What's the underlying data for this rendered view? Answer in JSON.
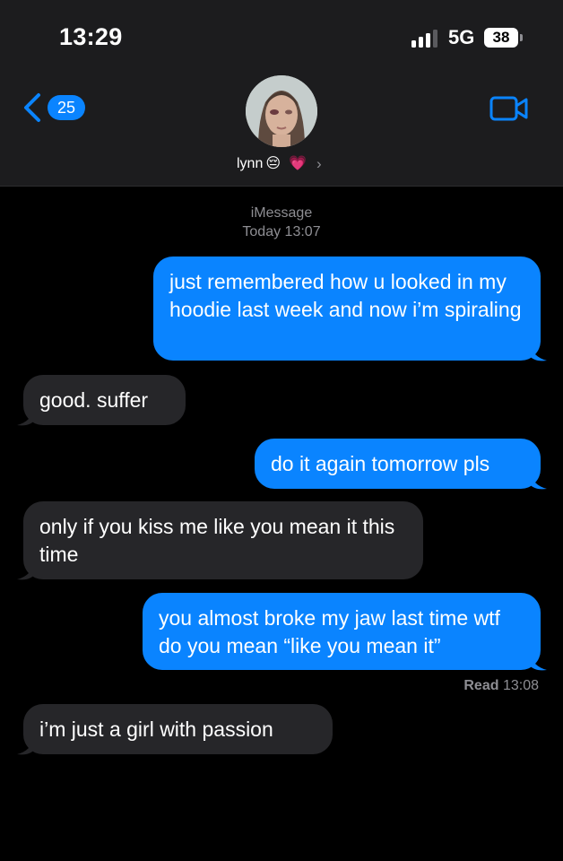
{
  "status_bar": {
    "time": "13:29",
    "network": "5G",
    "battery": "38"
  },
  "header": {
    "back_count": "25",
    "contact_name": "lynn",
    "contact_emojis": [
      "😔",
      "💗"
    ],
    "icons": [
      "back-chevron-icon",
      "video-camera-icon",
      "chevron-right-icon"
    ]
  },
  "conversation": {
    "service": "iMessage",
    "date": "Today 13:07",
    "messages": [
      {
        "direction": "sent",
        "text": "just remembered how u looked in my hoodie last week and now i’m spiraling"
      },
      {
        "direction": "received",
        "text": "good. suffer"
      },
      {
        "direction": "sent",
        "text": "do it again tomorrow pls"
      },
      {
        "direction": "received",
        "text": "only if you kiss me like you mean it this time"
      },
      {
        "direction": "sent",
        "text": "you almost broke my jaw last time wtf do you mean “like you mean it”"
      },
      {
        "direction": "received",
        "text": "i’m just a girl with passion"
      }
    ],
    "read_label": "Read",
    "read_time": "13:08"
  },
  "colors": {
    "sent": "#0a84ff",
    "received": "#262629",
    "header": "#1c1c1e",
    "accent": "#0a84ff"
  }
}
